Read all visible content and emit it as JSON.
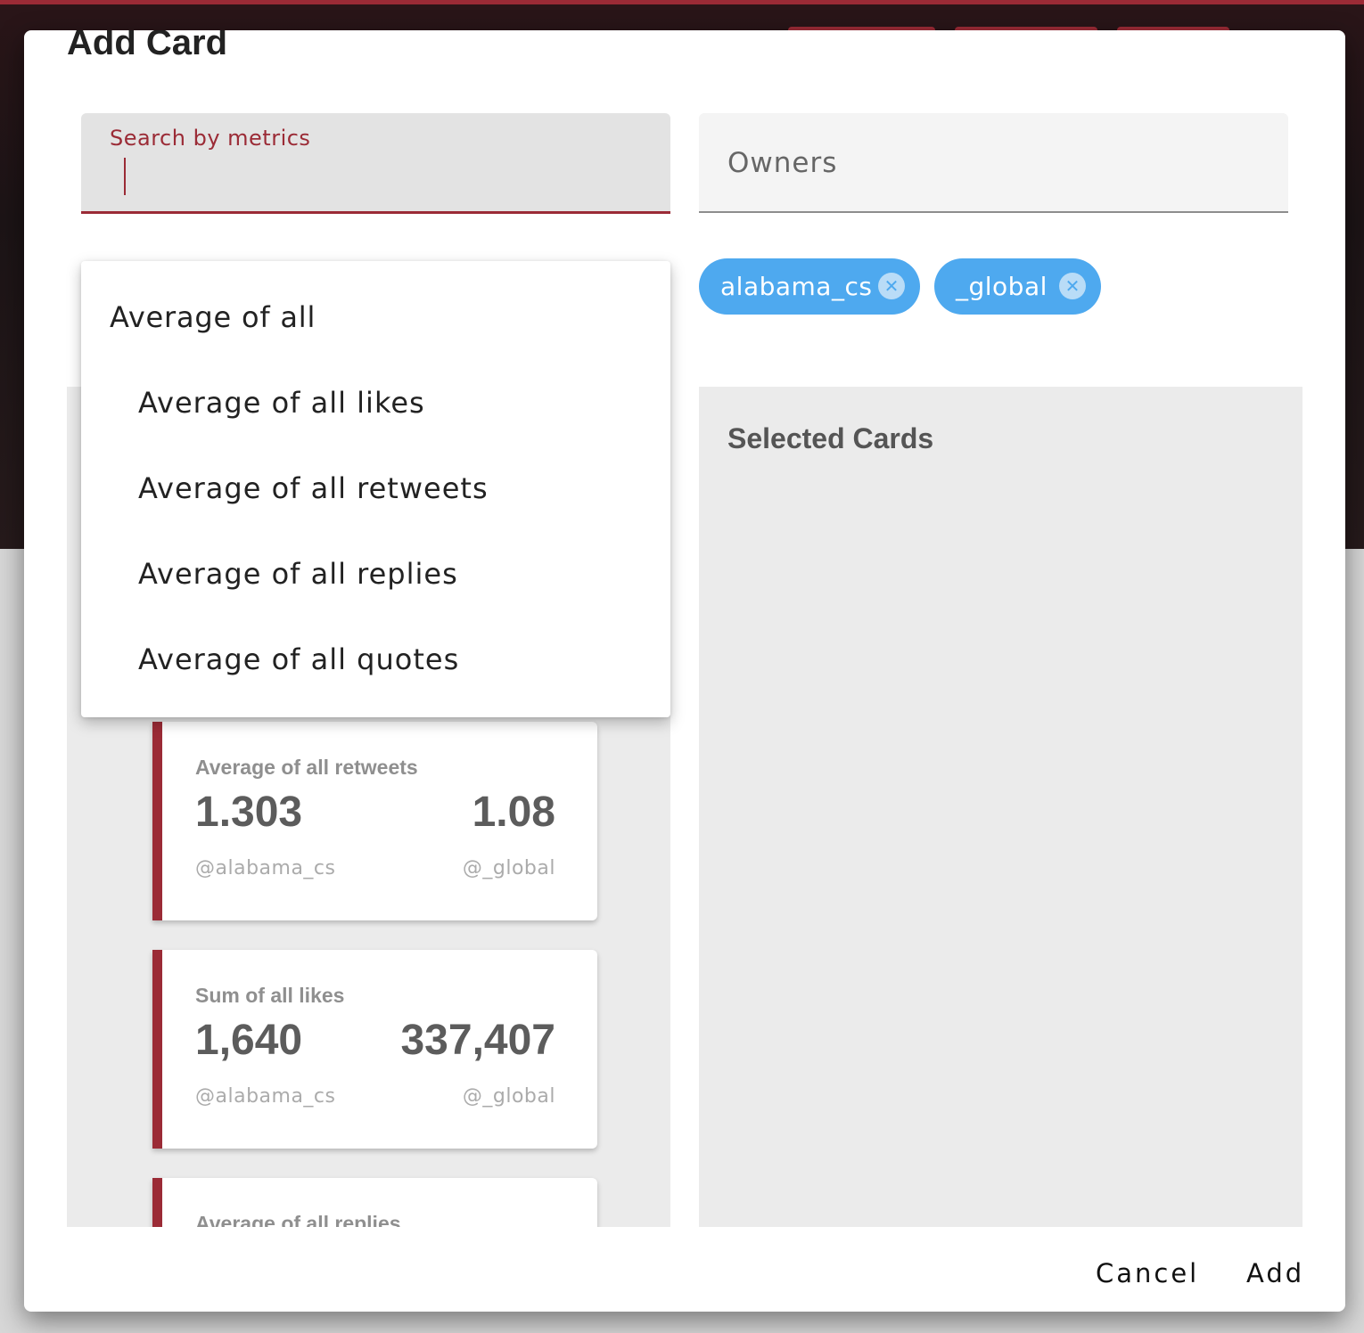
{
  "dialog": {
    "title": "Add Card",
    "search": {
      "label": "Search by metrics",
      "value": ""
    },
    "owners": {
      "placeholder": "Owners"
    },
    "chips": [
      {
        "label": "alabama_cs",
        "remove_icon": "close-circle-icon"
      },
      {
        "label": "_global",
        "remove_icon": "close-circle-icon"
      }
    ],
    "dropdown": {
      "group": "Average of all",
      "items": [
        "Average of all likes",
        "Average of all retweets",
        "Average of all replies",
        "Average of all quotes"
      ]
    },
    "cards": [
      {
        "title": "Average of all retweets",
        "left_value": "1.303",
        "left_handle": "@alabama_cs",
        "right_value": "1.08",
        "right_handle": "@_global"
      },
      {
        "title": "Sum of all likes",
        "left_value": "1,640",
        "left_handle": "@alabama_cs",
        "right_value": "337,407",
        "right_handle": "@_global"
      },
      {
        "title": "Average of all replies"
      }
    ],
    "selected_panel": {
      "title": "Selected Cards"
    },
    "buttons": {
      "cancel": "Cancel",
      "add": "Add"
    }
  },
  "colors": {
    "accent": "#9b2b36",
    "chip": "#4ea9ef",
    "panel_bg": "#ebebeb"
  }
}
